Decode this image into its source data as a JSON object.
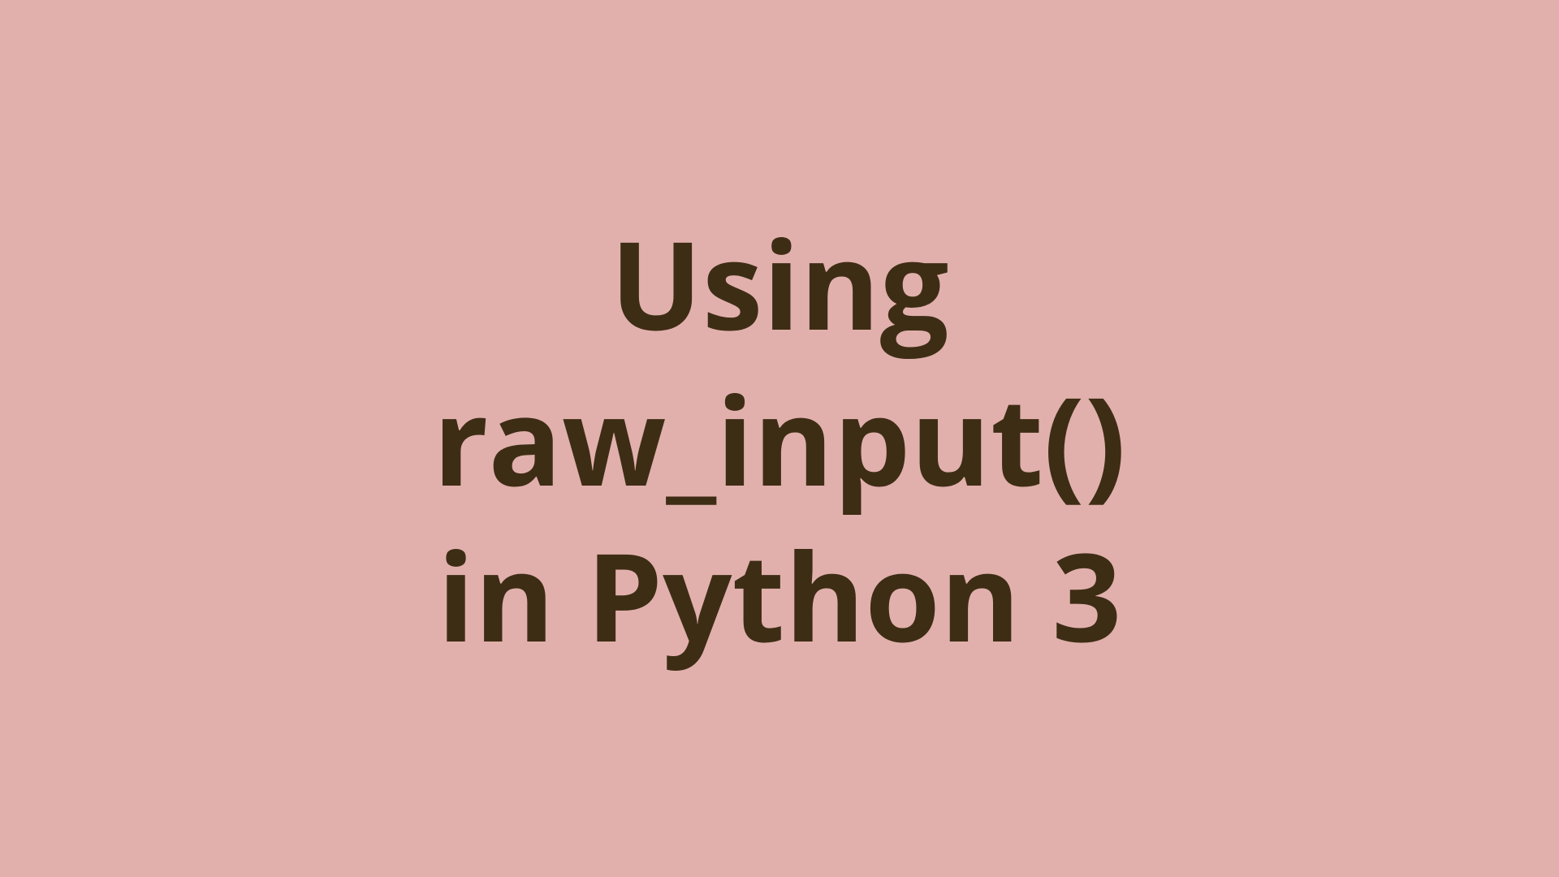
{
  "card": {
    "title": "Using\nraw_input()\nin Python 3",
    "background": "#e1b0ac",
    "text_color": "#3e2d15"
  }
}
